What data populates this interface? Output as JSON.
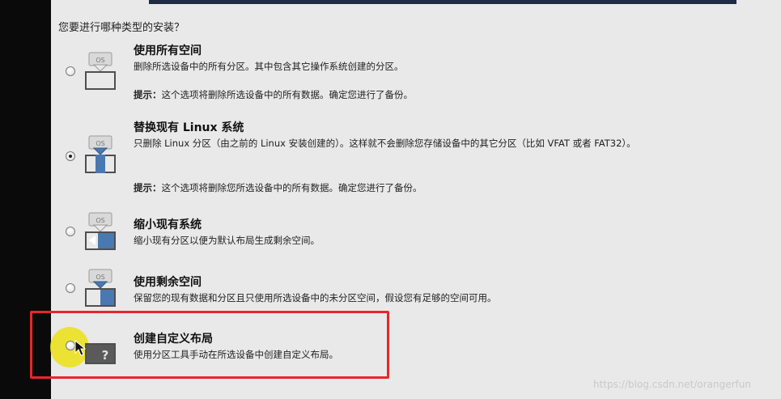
{
  "question": "您要进行哪种类型的安装？",
  "options": [
    {
      "title": "使用所有空间",
      "desc": "删除所选设备中的所有分区。其中包含其它操作系统创建的分区。",
      "hint_label": "提示：",
      "hint_text": "这个选项将删除所选设备中的所有数据。确定您进行了备份。",
      "icon_label": "OS",
      "selected": false
    },
    {
      "title": "替换现有 Linux 系统",
      "desc": "只删除 Linux 分区（由之前的 Linux 安装创建的）。这样就不会删除您存储设备中的其它分区（比如 VFAT 或者 FAT32）。",
      "hint_label": "提示：",
      "hint_text": "这个选项将删除您所选设备中的所有数据。确定您进行了备份。",
      "icon_label": "OS",
      "selected": true
    },
    {
      "title": "缩小现有系统",
      "desc": "缩小现有分区以便为默认布局生成剩余空间。",
      "icon_label": "OS",
      "selected": false
    },
    {
      "title": "使用剩余空间",
      "desc": "保留您的现有数据和分区且只使用所选设备中的未分区空间，假设您有足够的空间可用。",
      "icon_label": "OS",
      "selected": false
    },
    {
      "title": "创建自定义布局",
      "desc": "使用分区工具手动在所选设备中创建自定义布局。",
      "icon_label": "?",
      "selected": false
    }
  ],
  "watermark": "https://blog.csdn.net/orangerfun",
  "colors": {
    "background": "#e9e9e9",
    "left_bar": "#0a0a0a",
    "highlight_border": "#e8262b",
    "cursor_halo": "#ebe114",
    "disk_blue": "#4a78b0"
  }
}
